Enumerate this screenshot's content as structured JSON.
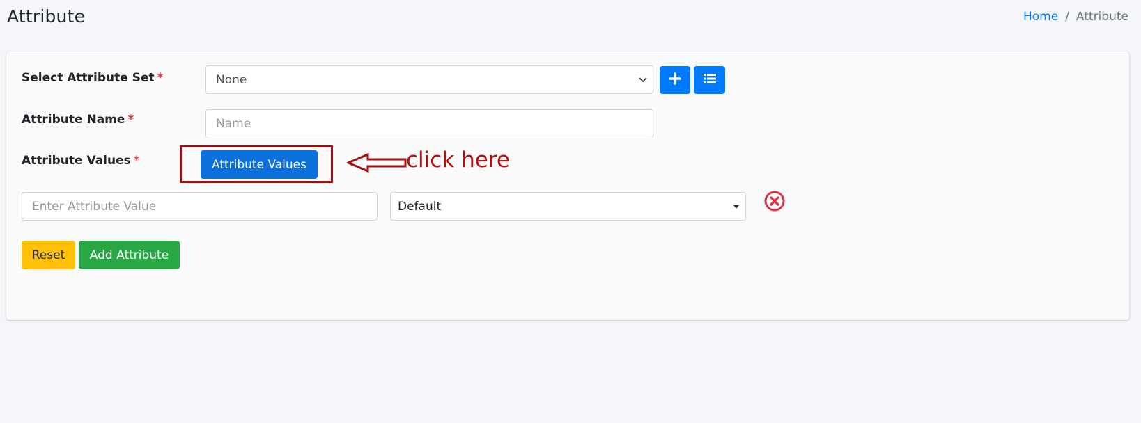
{
  "header": {
    "title": "Attribute",
    "breadcrumb": {
      "home": "Home",
      "separator": "/",
      "current": "Attribute"
    }
  },
  "form": {
    "attribute_set": {
      "label": "Select Attribute Set",
      "required_mark": "*",
      "selected": "None"
    },
    "add_set_icon": "plus-icon",
    "list_sets_icon": "list-icon",
    "attribute_name": {
      "label": "Attribute Name",
      "required_mark": "*",
      "placeholder": "Name",
      "value": ""
    },
    "attribute_values": {
      "label": "Attribute Values",
      "required_mark": "*",
      "button_label": "Attribute Values"
    },
    "value_row": {
      "value_placeholder": "Enter Attribute Value",
      "type_selected": "Default",
      "remove_icon": "close-circle-icon"
    },
    "actions": {
      "reset_label": "Reset",
      "add_label": "Add Attribute"
    }
  },
  "annotation": {
    "text": "click here"
  },
  "colors": {
    "primary": "#007bff",
    "warning": "#ffc107",
    "success": "#28a745",
    "danger": "#dc3545",
    "annotation": "#a50e0e"
  }
}
